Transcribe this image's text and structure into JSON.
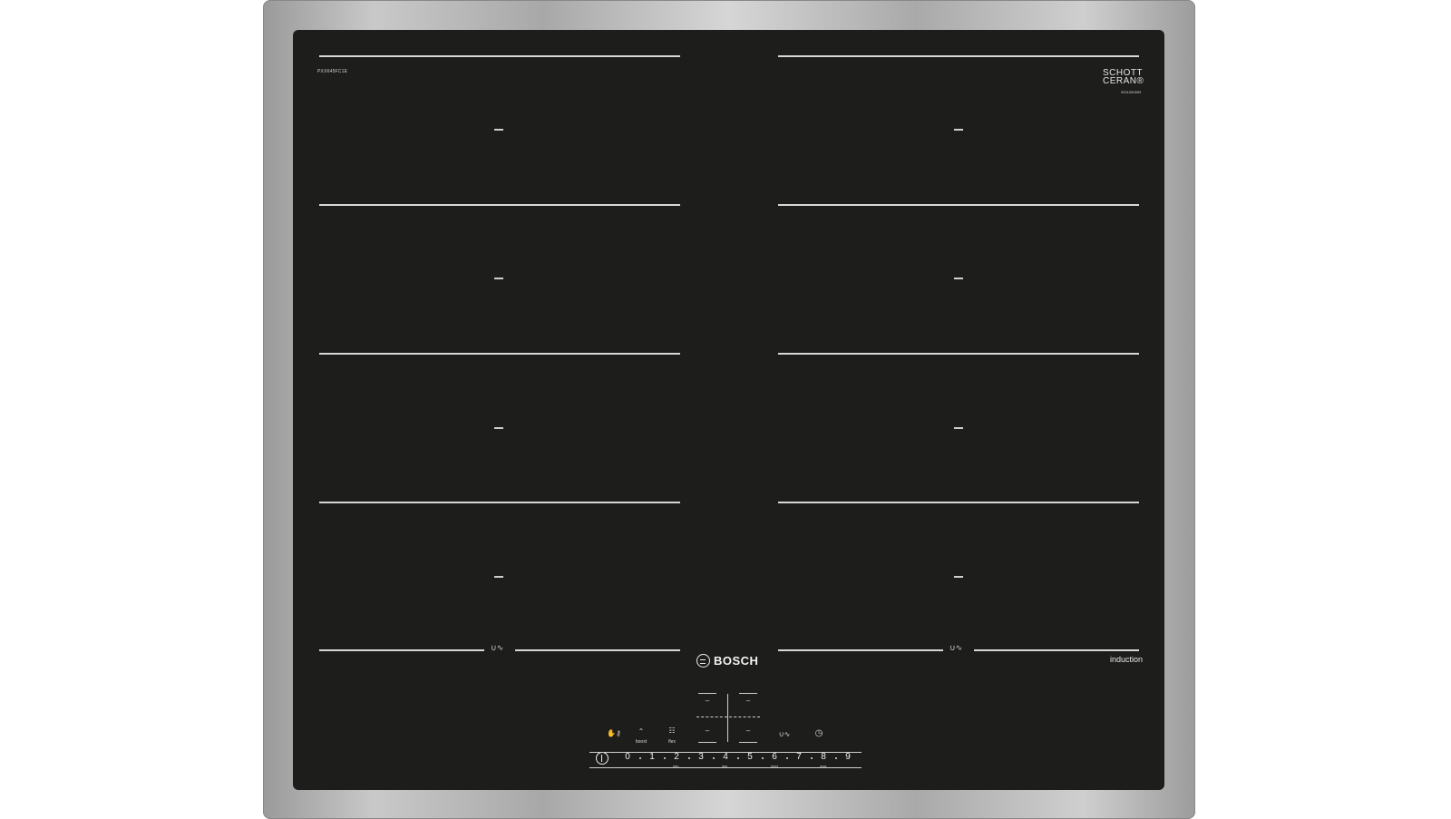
{
  "hob": {
    "model_code": "PXX645FC1E",
    "glass_brand_line1": "SCHOTT",
    "glass_brand_line2": "CERAN®",
    "serial_code": "9001069559",
    "brand": "BOSCH",
    "type_label": "induction"
  },
  "zones": {
    "left_column_dashes": [
      "–",
      "–",
      "–",
      "–"
    ],
    "right_column_dashes": [
      "–",
      "–",
      "–",
      "–"
    ],
    "flex_glyph": "∪∿"
  },
  "controls": {
    "childlock_icon": "hand-key-icon",
    "boost_icon": "boost-icon",
    "boost_label": "boost",
    "flex_icon": "flex-icon",
    "flex_label": "flex",
    "zone_link_icon": "flex-link-icon",
    "timer_icon": "clock-icon",
    "power_icon": "power-icon",
    "display_top_left": "–",
    "display_top_right": "–",
    "display_bottom_left": "–",
    "display_bottom_right": "–"
  },
  "slider": {
    "numbers": [
      "0",
      "1",
      "2",
      "3",
      "4",
      "5",
      "6",
      "7",
      "8",
      "9"
    ],
    "sublabels": {
      "min": "min",
      "low": "low",
      "med": "med",
      "max": "max"
    }
  }
}
